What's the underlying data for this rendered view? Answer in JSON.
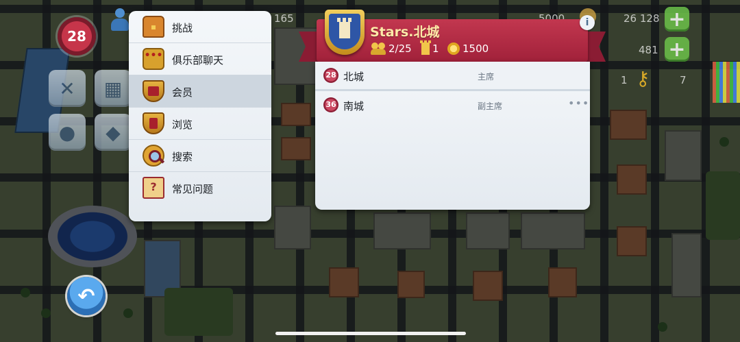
{
  "hud": {
    "level": "28",
    "counter_left": "165",
    "counter_mid": "5000",
    "counter_right": "26 128",
    "counter_right2": "481",
    "counter_small1": "1",
    "counter_small2": "7"
  },
  "menu": {
    "items": [
      {
        "label": "挑战",
        "icon": "treasure-chest-icon"
      },
      {
        "label": "俱乐部聊天",
        "icon": "chat-bubble-icon"
      },
      {
        "label": "会员",
        "icon": "club-shield-icon"
      },
      {
        "label": "浏览",
        "icon": "browse-shield-icon"
      },
      {
        "label": "搜索",
        "icon": "magnifier-icon"
      },
      {
        "label": "常见问题",
        "icon": "faq-book-icon"
      }
    ],
    "active_index": 2
  },
  "club": {
    "name": "Stars.北城",
    "members": "2/25",
    "towers": "1",
    "coins": "1500",
    "info_label": "i"
  },
  "member_list": [
    {
      "level": "28",
      "name": "北城",
      "role": "主席"
    },
    {
      "level": "36",
      "name": "南城",
      "role": "副主席",
      "more": "•••"
    }
  ],
  "colors": {
    "banner": "#b02a42",
    "panel": "#eef2f6",
    "level_badge": "#c6354a"
  }
}
